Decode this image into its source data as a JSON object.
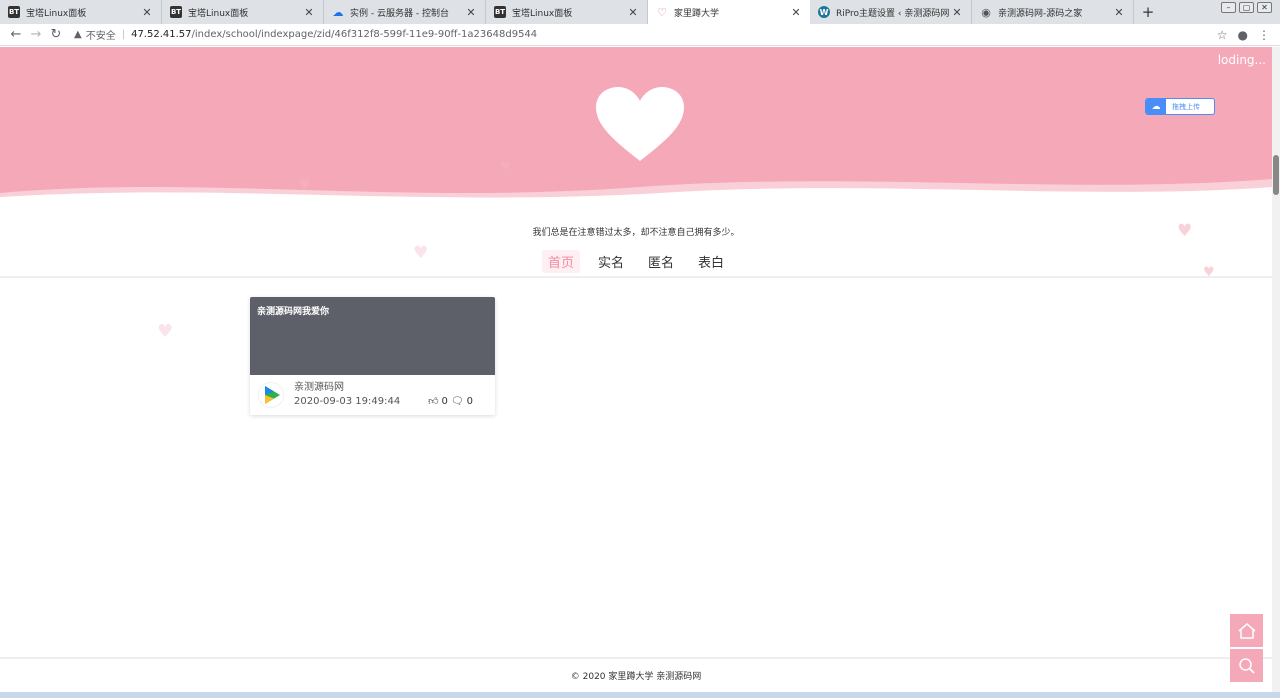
{
  "browser": {
    "tabs": [
      {
        "icon": "BT",
        "icon_type": "bt",
        "title": "宝塔Linux面板",
        "active": false
      },
      {
        "icon": "BT",
        "icon_type": "bt",
        "title": "宝塔Linux面板",
        "active": false
      },
      {
        "icon": "☁",
        "icon_type": "cloud",
        "title": "实例 - 云服务器 - 控制台",
        "active": false
      },
      {
        "icon": "BT",
        "icon_type": "bt",
        "title": "宝塔Linux面板",
        "active": false
      },
      {
        "icon": "♡",
        "icon_type": "heart",
        "title": "家里蹲大学",
        "active": true
      },
      {
        "icon": "W",
        "icon_type": "wp",
        "title": "RiPro主题设置 ‹ 亲测源码网 — W",
        "active": false
      },
      {
        "icon": "◉",
        "icon_type": "globe",
        "title": "亲测源码网-源码之家",
        "active": false
      }
    ],
    "tab_close": "✕",
    "new_tab": "+",
    "address": {
      "security_label": "不安全",
      "host": "47.52.41.57",
      "path": "/index/school/indexpage/zid/46f312f8-599f-11e9-90ff-1a23648d9544"
    }
  },
  "page": {
    "loading_text": "loding...",
    "upload_button": "拖拽上传",
    "motto": "我们总是在注意错过太多，却不注意自己拥有多少。",
    "nav": [
      {
        "label": "首页",
        "active": true
      },
      {
        "label": "实名",
        "active": false
      },
      {
        "label": "匿名",
        "active": false
      },
      {
        "label": "表白",
        "active": false
      }
    ],
    "card": {
      "title": "亲测源码网我爱你",
      "author": "亲测源码网",
      "date": "2020-09-03 19:49:44",
      "likes": "0",
      "comments": "0"
    },
    "footer": "© 2020 家里蹲大学  亲测源码网"
  },
  "colors": {
    "hero_pink": "#f5a8b8",
    "accent_pink": "#f48aa0",
    "card_cover": "#5d6069",
    "upload_blue": "#4a8df8"
  }
}
